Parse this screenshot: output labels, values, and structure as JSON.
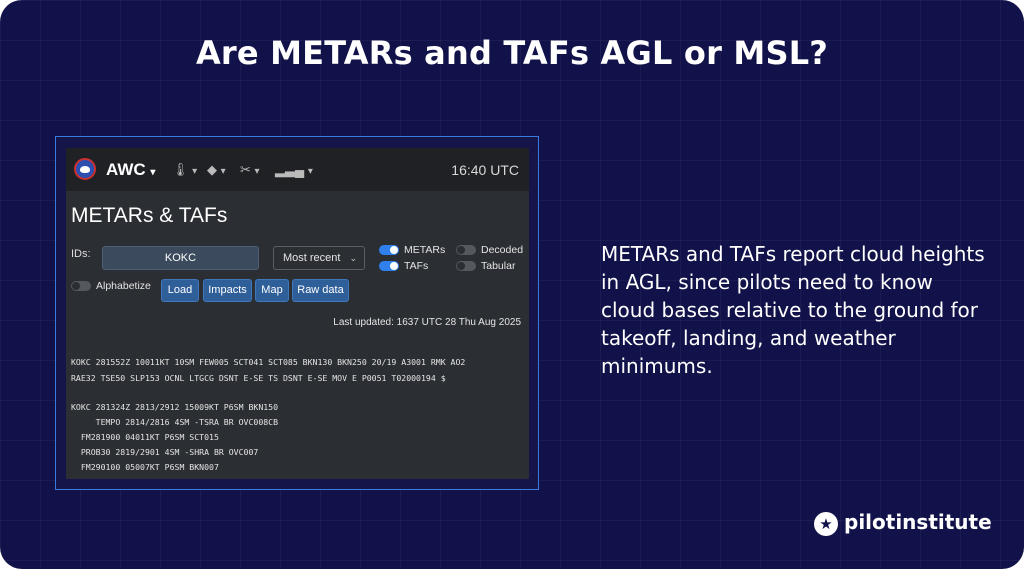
{
  "headline": "Are METARs and TAFs AGL or MSL?",
  "body_text": "METARs and TAFs report cloud heights in AGL, since pilots need to know cloud bases relative to the ground for takeoff, landing, and weather minimums.",
  "brand_footer": "pilotinstitute",
  "colors": {
    "background": "#12124a",
    "accent": "#2f80ed",
    "frame": "#3a7be0"
  },
  "app": {
    "brand": "AWC",
    "nav_icons": [
      "thermometer-icon",
      "diamond-icon",
      "tools-icon",
      "signal-bars-icon"
    ],
    "utc_time": "16:40 UTC",
    "page_title": "METARs & TAFs",
    "ids_label": "IDs:",
    "ids_value": "KOKC",
    "select_value": "Most recent",
    "toggles": {
      "metars": {
        "label": "METARs",
        "on": true
      },
      "tafs": {
        "label": "TAFs",
        "on": true
      },
      "decoded": {
        "label": "Decoded",
        "on": false
      },
      "tabular": {
        "label": "Tabular",
        "on": false
      },
      "alphabetize": {
        "label": "Alphabetize",
        "on": false
      }
    },
    "buttons": {
      "load": "Load",
      "impacts": "Impacts",
      "map": "Map",
      "raw": "Raw data"
    },
    "last_updated": "Last updated: 1637 UTC 28 Thu Aug 2025",
    "metar_lines": [
      "KOKC 281552Z 10011KT 10SM FEW005 SCT041 SCT085 BKN130 BKN250 20/19 A3001 RMK AO2",
      "RAE32 TSE50 SLP153 OCNL LTGCG DSNT E-SE TS DSNT E-SE MOV E P0051 T02000194 $"
    ],
    "taf_lines": [
      "KOKC 281324Z 2813/2912 15009KT P6SM BKN150",
      "     TEMPO 2814/2816 4SM -TSRA BR OVC008CB",
      "  FM281900 04011KT P6SM SCT015",
      "  PROB30 2819/2901 4SM -SHRA BR OVC007",
      "  FM290100 05007KT P6SM BKN007"
    ]
  }
}
